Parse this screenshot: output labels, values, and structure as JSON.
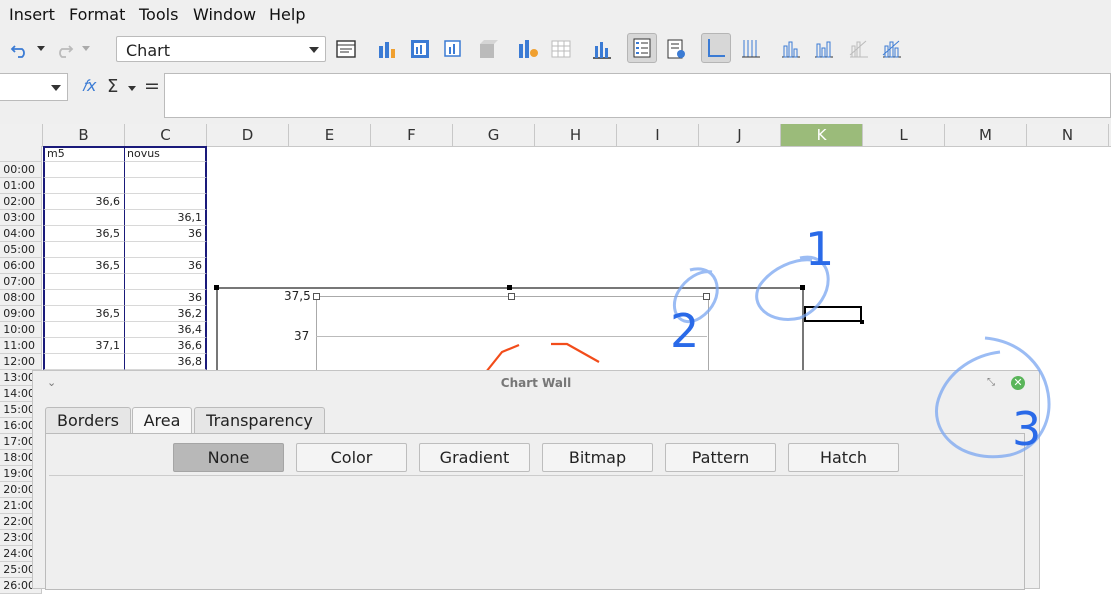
{
  "menu": [
    "Insert",
    "Format",
    "Tools",
    "Window",
    "Help"
  ],
  "toolbar": {
    "chart_element_select": "Chart",
    "icons": [
      "undo-icon",
      "redo-icon",
      "format-selection-icon",
      "chart-type-icon",
      "data-table-icon",
      "data-ranges-icon",
      "3d-view-icon",
      "chart-wizard-icon",
      "table-icon",
      "titles-icon",
      "legend-toggle-icon",
      "legend-icon",
      "axes-icon",
      "grid-icon",
      "bar-chart-icon",
      "bar-chart-icon-2",
      "bar-chart-icon-3",
      "bar-chart-icon-4"
    ]
  },
  "formula_bar": {
    "fx_label": "𝑓x",
    "sum_label": "Σ",
    "equals_label": "=",
    "value": ""
  },
  "columns": [
    "B",
    "C",
    "D",
    "E",
    "F",
    "G",
    "H",
    "I",
    "J",
    "K",
    "L",
    "M",
    "N"
  ],
  "selected_column": "K",
  "rows": [
    {
      "a": "",
      "b": "m5",
      "c": "novus"
    },
    {
      "a": "00:00",
      "b": "",
      "c": ""
    },
    {
      "a": "01:00",
      "b": "",
      "c": ""
    },
    {
      "a": "02:00",
      "b": "36,6",
      "c": ""
    },
    {
      "a": "03:00",
      "b": "",
      "c": "36,1"
    },
    {
      "a": "04:00",
      "b": "36,5",
      "c": "36"
    },
    {
      "a": "05:00",
      "b": "",
      "c": ""
    },
    {
      "a": "06:00",
      "b": "36,5",
      "c": "36"
    },
    {
      "a": "07:00",
      "b": "",
      "c": ""
    },
    {
      "a": "08:00",
      "b": "",
      "c": "36"
    },
    {
      "a": "09:00",
      "b": "36,5",
      "c": "36,2"
    },
    {
      "a": "10:00",
      "b": "",
      "c": "36,4"
    },
    {
      "a": "11:00",
      "b": "37,1",
      "c": "36,6"
    },
    {
      "a": "12:00",
      "b": "",
      "c": "36,8"
    },
    {
      "a": "13:00"
    },
    {
      "a": "14:00"
    },
    {
      "a": "15:00"
    },
    {
      "a": "16:00"
    },
    {
      "a": "17:00"
    },
    {
      "a": "18:00"
    },
    {
      "a": "19:00"
    },
    {
      "a": "20:00"
    },
    {
      "a": "21:00"
    },
    {
      "a": "22:00"
    },
    {
      "a": "23:00"
    },
    {
      "a": "24:00"
    },
    {
      "a": "25:00"
    },
    {
      "a": "26:00"
    }
  ],
  "chart": {
    "y_ticks": [
      "37,5",
      "37"
    ],
    "series_color": "#f24c1a"
  },
  "dialog": {
    "title": "Chart Wall",
    "tabs": [
      "Borders",
      "Area",
      "Transparency"
    ],
    "active_tab": "Area",
    "area_buttons": [
      "None",
      "Color",
      "Gradient",
      "Bitmap",
      "Pattern",
      "Hatch"
    ],
    "pressed_button": "None"
  },
  "annotations": [
    "1",
    "2",
    "3"
  ],
  "colors": {
    "annotation": "#2a6ae8",
    "selected_column": "#9bbb7a",
    "close": "#5ab55a"
  }
}
